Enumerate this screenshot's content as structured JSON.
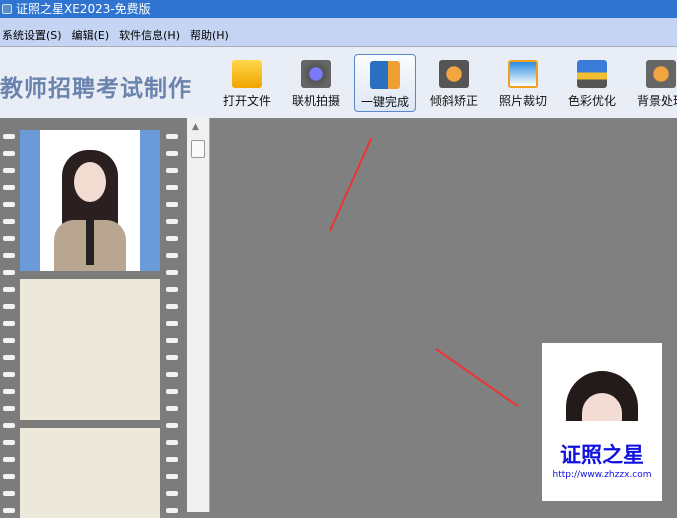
{
  "window": {
    "title": "证照之星XE2023-免费版"
  },
  "menu": [
    "系统设置(S)",
    "编辑(E)",
    "软件信息(H)",
    "帮助(H)"
  ],
  "toolbar": {
    "app_title": "教师招聘考试制作",
    "tools": [
      {
        "label": "打开文件",
        "icon": "folder-icon"
      },
      {
        "label": "联机拍摄",
        "icon": "camera-icon"
      },
      {
        "label": "一键完成",
        "icon": "one-click-icon",
        "active": true
      },
      {
        "label": "倾斜矫正",
        "icon": "tilt-correct-icon"
      },
      {
        "label": "照片裁切",
        "icon": "crop-icon"
      },
      {
        "label": "色彩优化",
        "icon": "color-optimize-icon"
      },
      {
        "label": "背景处理",
        "icon": "background-icon"
      }
    ]
  },
  "preview": {
    "watermark": "证照之星",
    "url": "http://www.zhzzx.com"
  },
  "colors": {
    "titlebar": "#2f74d0",
    "menubar": "#c4d4f2",
    "toolbar": "#e9edf6",
    "workspace": "#808080",
    "arrow": "#e33333"
  }
}
